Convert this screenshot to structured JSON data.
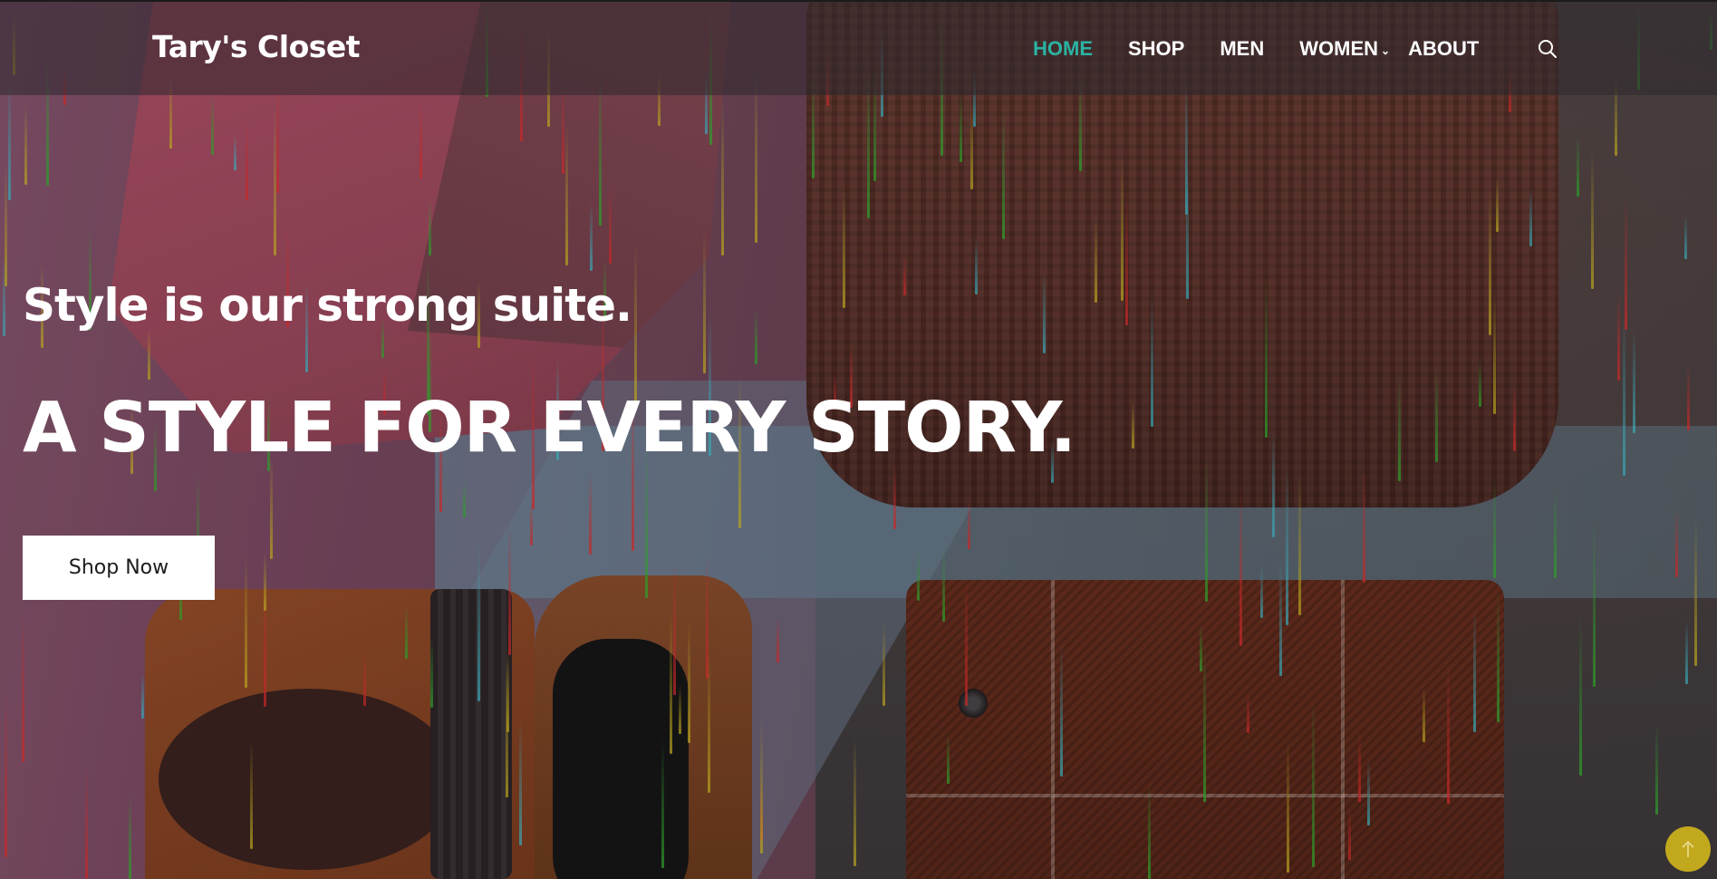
{
  "site": {
    "brand": "Tary's Closet"
  },
  "nav": {
    "items": [
      {
        "label": "HOME",
        "active": true
      },
      {
        "label": "SHOP",
        "active": false
      },
      {
        "label": "MEN",
        "active": false
      },
      {
        "label": "WOMEN",
        "active": false,
        "has_dropdown": true
      },
      {
        "label": "ABOUT",
        "active": false
      }
    ],
    "search_icon": "search-icon"
  },
  "hero": {
    "tagline": "Style is our strong suite.",
    "headline": "A STYLE FOR EVERY STORY.",
    "cta_label": "Shop Now"
  },
  "back_to_top": {
    "icon": "arrow-up-icon"
  },
  "colors": {
    "accent": "#2bb3a3",
    "back_to_top": "#c2a81c",
    "header_overlay": "rgba(45,40,45,0.55)"
  }
}
